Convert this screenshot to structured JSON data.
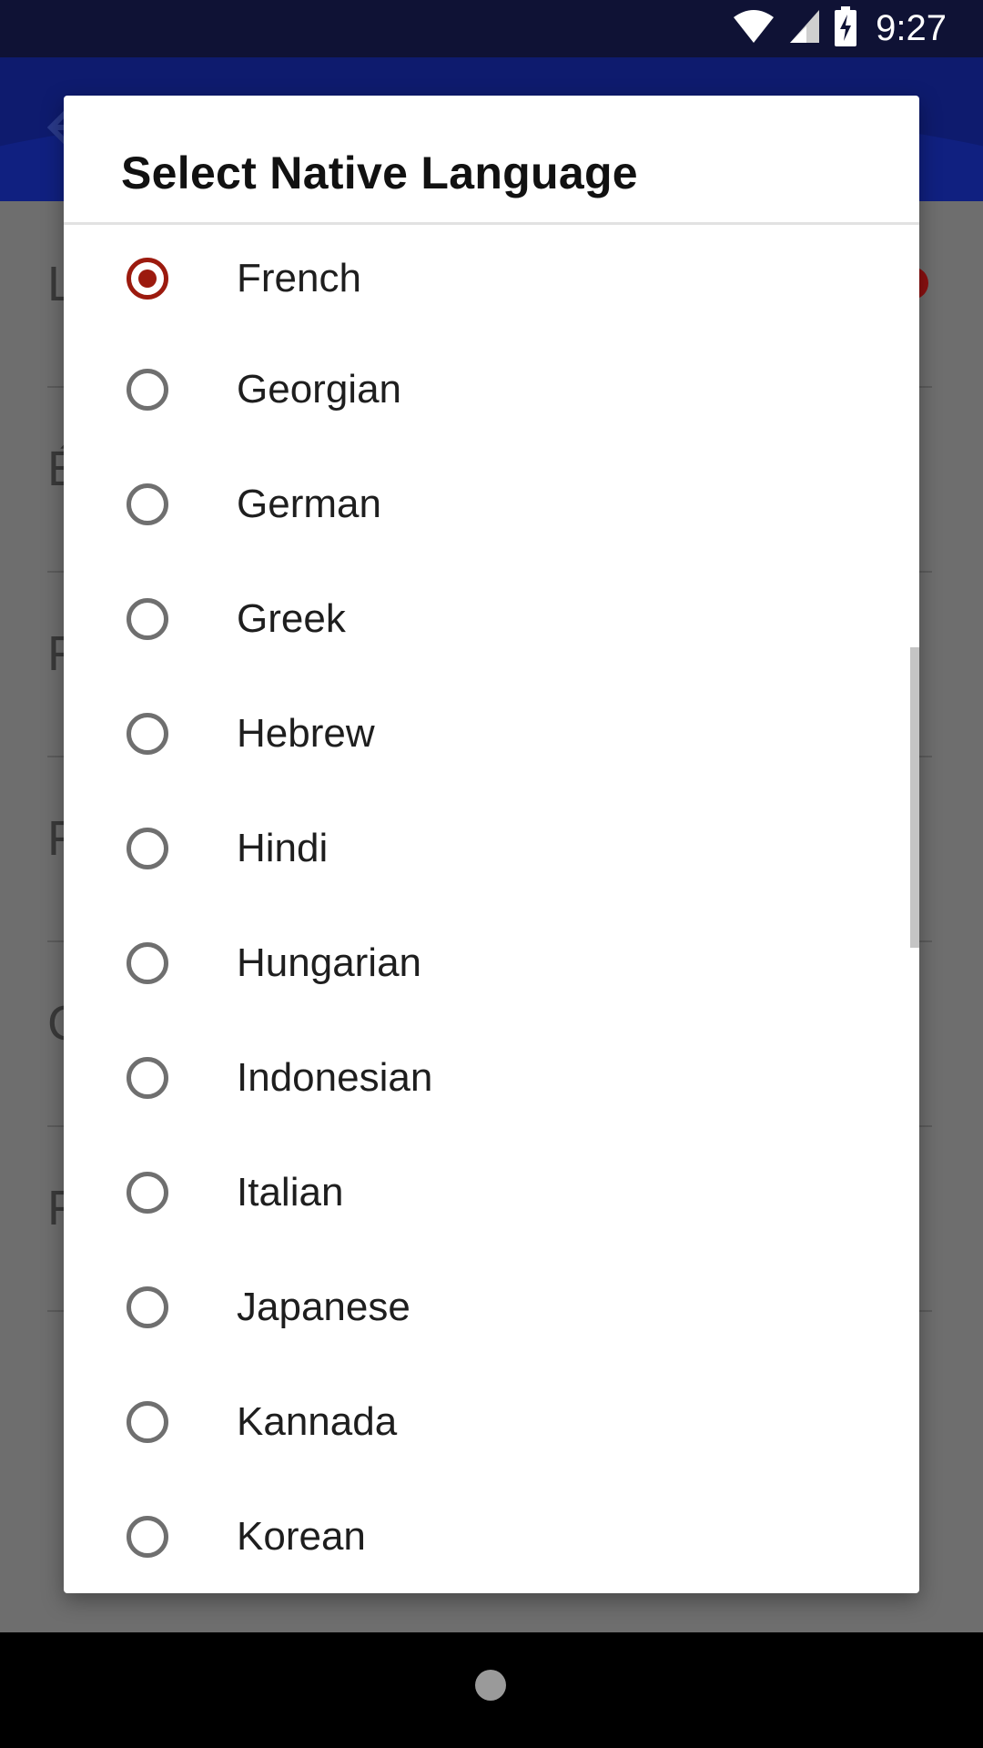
{
  "status_bar": {
    "time": "9:27"
  },
  "background_rows": [
    {
      "letter": "L"
    },
    {
      "letter": "É"
    },
    {
      "letter": "F"
    },
    {
      "letter": "F"
    },
    {
      "letter": "C"
    },
    {
      "letter": "F"
    }
  ],
  "dialog": {
    "title": "Select Native Language",
    "options": [
      {
        "label": "French",
        "selected": true
      },
      {
        "label": "Georgian",
        "selected": false
      },
      {
        "label": "German",
        "selected": false
      },
      {
        "label": "Greek",
        "selected": false
      },
      {
        "label": "Hebrew",
        "selected": false
      },
      {
        "label": "Hindi",
        "selected": false
      },
      {
        "label": "Hungarian",
        "selected": false
      },
      {
        "label": "Indonesian",
        "selected": false
      },
      {
        "label": "Italian",
        "selected": false
      },
      {
        "label": "Japanese",
        "selected": false
      },
      {
        "label": "Kannada",
        "selected": false
      },
      {
        "label": "Korean",
        "selected": false
      }
    ]
  },
  "colors": {
    "radio_selected": "#9c1a0e",
    "radio_unselected": "#6f6f6f",
    "app_bar": "#0e1b6e",
    "status_bar": "#0f1235"
  }
}
